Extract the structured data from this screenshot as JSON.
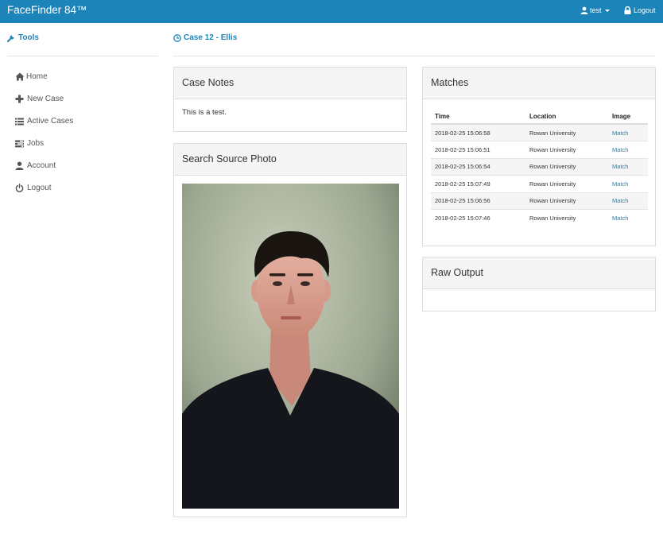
{
  "navbar": {
    "brand": "FaceFinder 84™",
    "user_label": "test",
    "logout_label": "Logout"
  },
  "sidebar": {
    "title": "Tools",
    "items": [
      {
        "label": "Home",
        "icon": "home-icon"
      },
      {
        "label": "New Case",
        "icon": "plus-icon"
      },
      {
        "label": "Active Cases",
        "icon": "list-icon"
      },
      {
        "label": "Jobs",
        "icon": "tasks-icon"
      },
      {
        "label": "Account",
        "icon": "user-icon"
      },
      {
        "label": "Logout",
        "icon": "power-icon"
      }
    ]
  },
  "case": {
    "title": "Case 12 - Ellis"
  },
  "case_notes": {
    "heading": "Case Notes",
    "text": "This is a test."
  },
  "search_photo": {
    "heading": "Search Source Photo"
  },
  "matches": {
    "heading": "Matches",
    "columns": [
      "Time",
      "Location",
      "Image"
    ],
    "rows": [
      [
        "2018-02-25 15:06:58",
        "Rowan University",
        "Match"
      ],
      [
        "2018-02-25 15:06:51",
        "Rowan University",
        "Match"
      ],
      [
        "2018-02-25 15:06:54",
        "Rowan University",
        "Match"
      ],
      [
        "2018-02-25 15:07:49",
        "Rowan University",
        "Match"
      ],
      [
        "2018-02-25 15:06:56",
        "Rowan University",
        "Match"
      ],
      [
        "2018-02-25 15:07:46",
        "Rowan University",
        "Match"
      ]
    ]
  },
  "raw_output": {
    "heading": "Raw Output",
    "text": ""
  },
  "colors": {
    "navbar": "#1c84b8",
    "accent": "#1c84b8",
    "panel_header": "#f5f5f5"
  }
}
